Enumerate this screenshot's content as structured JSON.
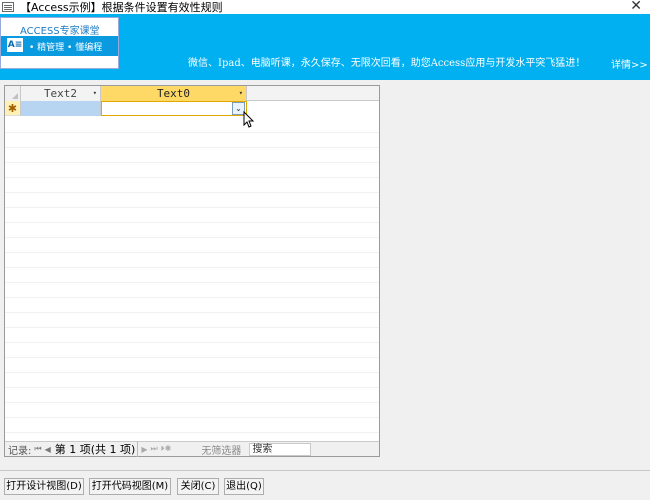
{
  "window": {
    "title": "【Access示例】根据条件设置有效性规则",
    "close_glyph": "✕"
  },
  "banner": {
    "logo_title": "ACCESS专家课堂",
    "logo_icon_text": "A≡",
    "logo_tags": "•  精管理  •  懂编程",
    "slogan": "微信、Ipad、电脑听课，永久保存、无限次回看，助您Access应用与开发水平突飞猛进！",
    "more": "详情>>"
  },
  "datasheet": {
    "columns": [
      {
        "label": "Text2",
        "dropdown": "▾"
      },
      {
        "label": "Text0",
        "dropdown": "▾"
      }
    ],
    "new_row_marker": "✱",
    "combo_arrow": "⌄"
  },
  "navigation": {
    "record_label": "记录:",
    "first": "⏮",
    "prev": "◀",
    "position": "第 1 项(共 1 项)",
    "next": "▶",
    "last": "⏭",
    "new": "⏵✱",
    "filter": "无筛选器",
    "search_placeholder": "搜索"
  },
  "buttons": {
    "design_view": "打开设计视图(D)",
    "code_view": "打开代码视图(M)",
    "close": "关闭(C)",
    "exit": "退出(Q)"
  },
  "colors": {
    "banner": "#00b0f0",
    "active_column_header": "#ffd966",
    "selected_cell": "#b7d4f0"
  }
}
